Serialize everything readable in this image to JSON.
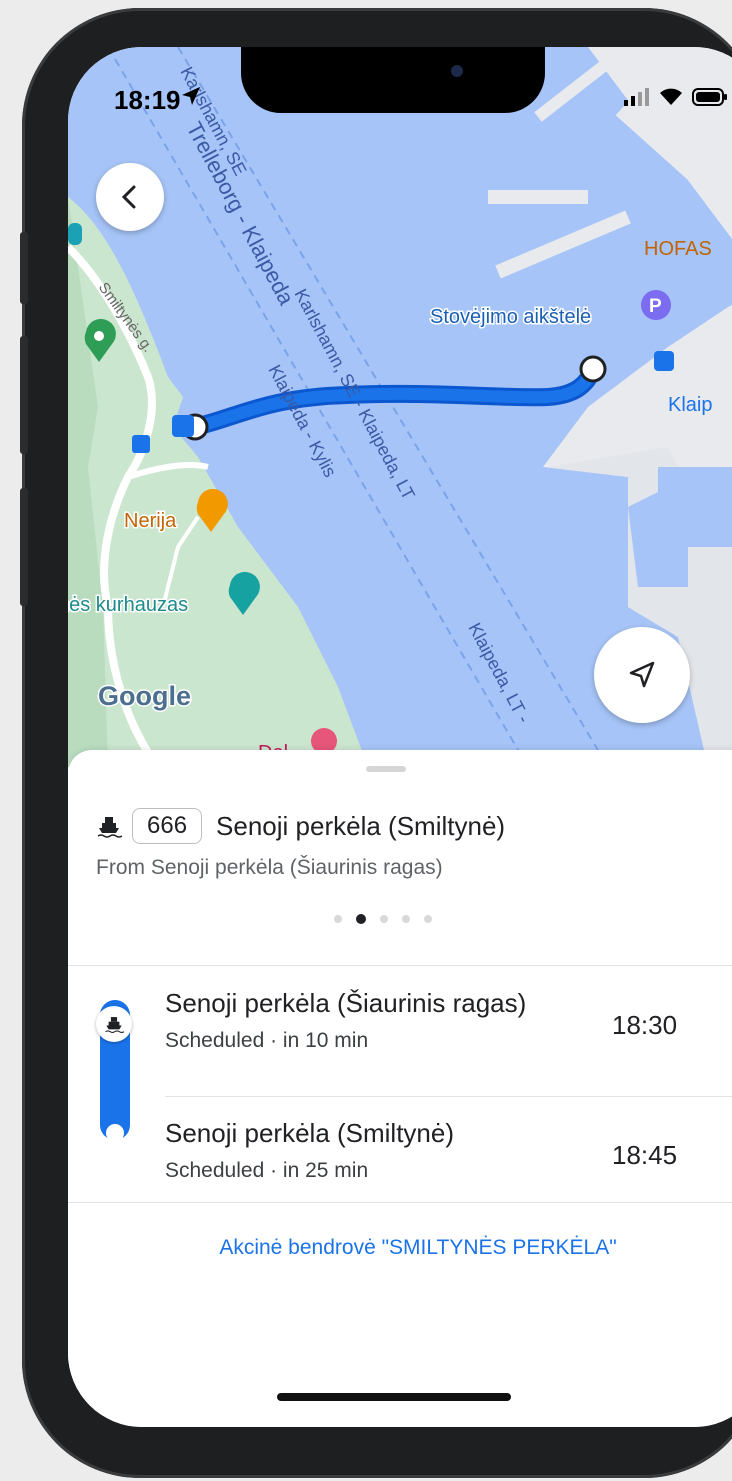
{
  "status_bar": {
    "time": "18:19"
  },
  "map": {
    "route_labels": [
      "Karlshamn, SE",
      "Trelleborg - Klaipeda",
      "Karlshamn, SE - Klaipeda, LT",
      "Klaipeda - Kylis",
      "Klaipeda, LT -"
    ],
    "street_label": "Smiltynės g.",
    "poi_parking": "Stovėjimo aikštelė",
    "poi_hofas": "HOFAS",
    "poi_klaip": "Klaip",
    "poi_nerija": "Nerija",
    "poi_kurhauzas": "nės kurhauzas",
    "poi_partial": "Del",
    "google_logo": "Google",
    "route_color": "#1a73e8",
    "water_color": "#a6c4f7",
    "park_color": "#cbe6cf"
  },
  "route": {
    "mode_icon": "ferry-icon",
    "number": "666",
    "destination": "Senoji perkėla (Smiltynė)",
    "from": "From Senoji perkėla (Šiaurinis ragas)",
    "page_dots": 5,
    "active_dot": 2
  },
  "stops": [
    {
      "name": "Senoji perkėla (Šiaurinis ragas)",
      "status": "Scheduled · in 10 min",
      "time": "18:30"
    },
    {
      "name": "Senoji perkėla (Smiltynė)",
      "status": "Scheduled · in 25 min",
      "time": "18:45"
    }
  ],
  "operator": "Akcinė bendrovė \"SMILTYNĖS PERKĖLA\""
}
